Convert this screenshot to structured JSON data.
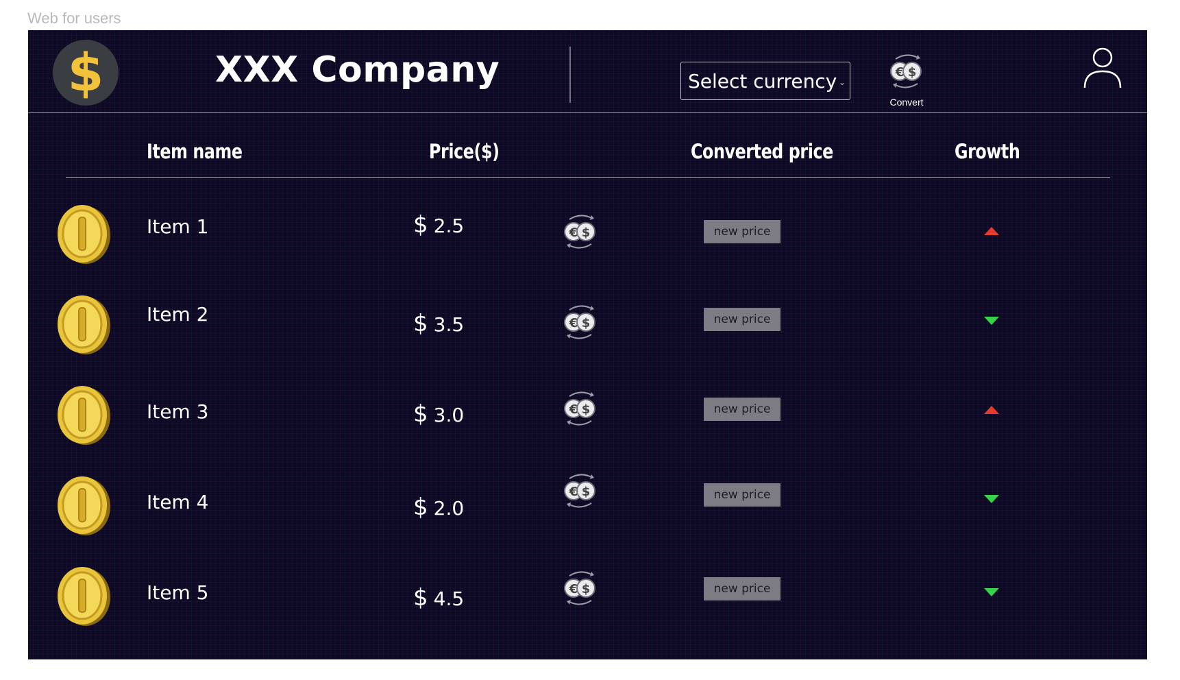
{
  "frame_label": "Web for users",
  "header": {
    "logo_symbol": "$",
    "company_name": "XXX Company",
    "currency_select": {
      "value": "Select currency",
      "chevron": "⌄"
    },
    "convert_label": "Convert",
    "user_icon": "user-icon"
  },
  "table": {
    "columns": [
      "Item name",
      "Price($)",
      "Converted price",
      "Growth"
    ],
    "rows": [
      {
        "name": "Item 1",
        "currency": "$",
        "price": "2.5",
        "converted": "new price",
        "growth": "up"
      },
      {
        "name": "Item 2",
        "currency": "$",
        "price": "3.5",
        "converted": "new price",
        "growth": "down"
      },
      {
        "name": "Item 3",
        "currency": "$",
        "price": "3.0",
        "converted": "new price",
        "growth": "up"
      },
      {
        "name": "Item 4",
        "currency": "$",
        "price": "2.0",
        "converted": "new price",
        "growth": "down"
      },
      {
        "name": "Item 5",
        "currency": "$",
        "price": "4.5",
        "converted": "new price",
        "growth": "down"
      }
    ]
  },
  "colors": {
    "background": "#0d0a25",
    "coin": "#e8c53a",
    "growth_up": "#e53a2c",
    "growth_down": "#35d24a",
    "new_price_bg": "#7d7c85"
  }
}
